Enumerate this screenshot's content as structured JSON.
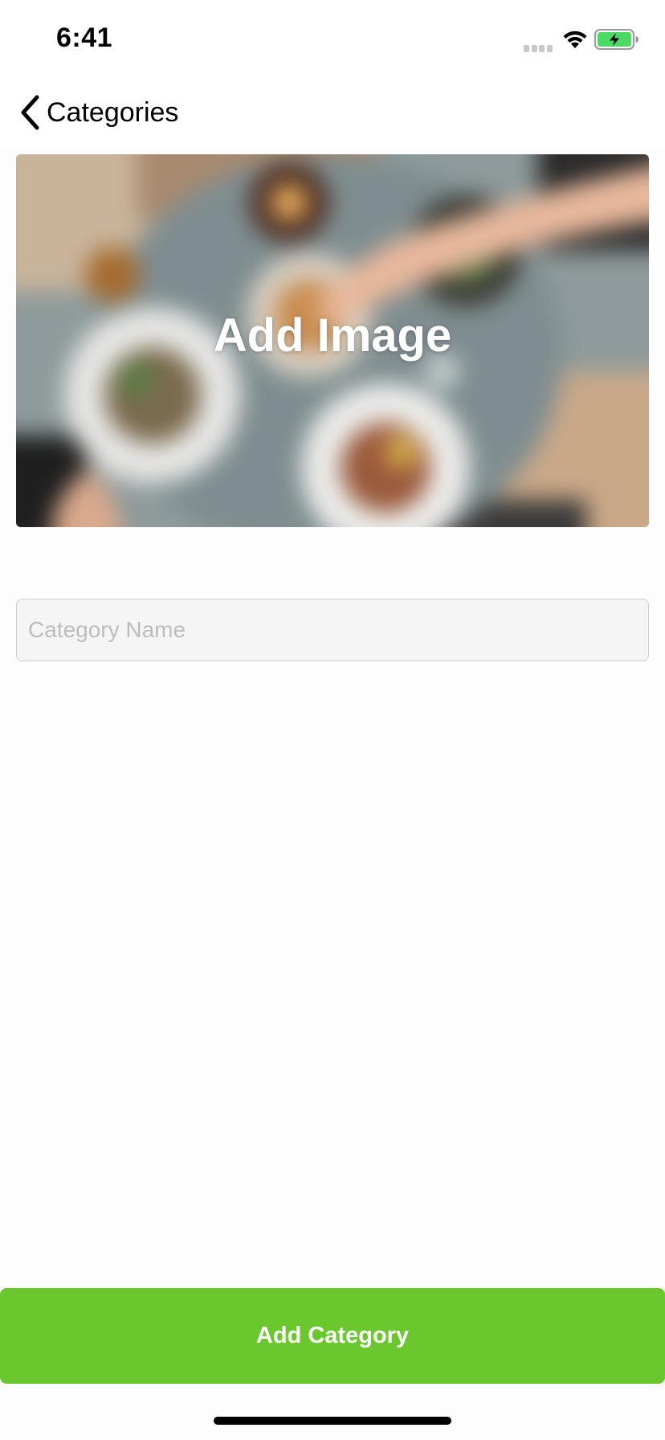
{
  "status_bar": {
    "time": "6:41",
    "icons": [
      "signal-icon",
      "wifi-icon",
      "battery-charging-icon"
    ]
  },
  "nav": {
    "back_label": "Categories",
    "back_icon": "chevron-left-icon"
  },
  "image_picker": {
    "label": "Add Image"
  },
  "form": {
    "category_name_placeholder": "Category Name",
    "category_name_value": ""
  },
  "actions": {
    "add_category_label": "Add Category"
  },
  "colors": {
    "accent_green": "#6ac72e",
    "battery_green": "#4cd964"
  }
}
